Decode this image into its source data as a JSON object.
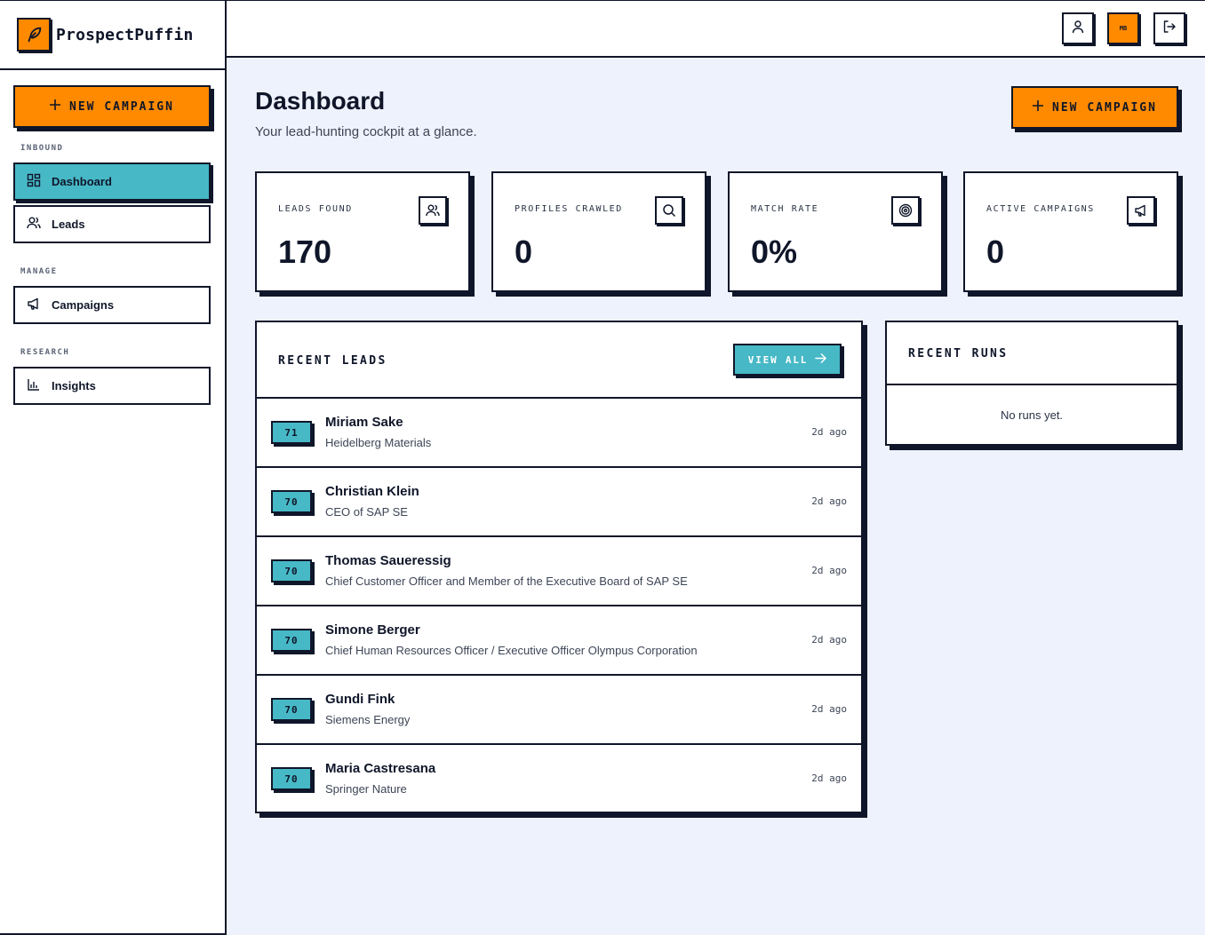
{
  "brand": {
    "name": "ProspectPuffin",
    "logo_icon": "feather-icon"
  },
  "sidebar": {
    "new_campaign_label": "NEW CAMPAIGN",
    "sections": [
      {
        "label": "INBOUND",
        "items": [
          {
            "label": "Dashboard",
            "icon": "grid-icon",
            "active": true
          },
          {
            "label": "Leads",
            "icon": "users-icon",
            "active": false
          }
        ]
      },
      {
        "label": "MANAGE",
        "items": [
          {
            "label": "Campaigns",
            "icon": "megaphone-icon",
            "active": false
          }
        ]
      },
      {
        "label": "RESEARCH",
        "items": [
          {
            "label": "Insights",
            "icon": "bar-chart-icon",
            "active": false
          }
        ]
      }
    ]
  },
  "topbar": {
    "avatar_initials": "MB",
    "icons": [
      "user-icon",
      "avatar",
      "logout-icon"
    ]
  },
  "page": {
    "title": "Dashboard",
    "subtitle": "Your lead-hunting cockpit at a glance.",
    "new_campaign_label": "NEW CAMPAIGN"
  },
  "stats": [
    {
      "label": "LEADS FOUND",
      "value": "170",
      "icon": "users-icon"
    },
    {
      "label": "PROFILES CRAWLED",
      "value": "0",
      "icon": "search-icon"
    },
    {
      "label": "MATCH RATE",
      "value": "0%",
      "icon": "target-icon"
    },
    {
      "label": "ACTIVE CAMPAIGNS",
      "value": "0",
      "icon": "megaphone-icon"
    }
  ],
  "recent_leads": {
    "title": "RECENT LEADS",
    "view_all_label": "VIEW ALL",
    "rows": [
      {
        "score": "71",
        "name": "Miriam Sake",
        "subtitle": "Heidelberg Materials",
        "time": "2d ago"
      },
      {
        "score": "70",
        "name": "Christian Klein",
        "subtitle": "CEO of SAP SE",
        "time": "2d ago"
      },
      {
        "score": "70",
        "name": "Thomas Saueressig",
        "subtitle": "Chief Customer Officer and Member of the Executive Board of SAP SE",
        "time": "2d ago"
      },
      {
        "score": "70",
        "name": "Simone Berger",
        "subtitle": "Chief Human Resources Officer / Executive Officer Olympus Corporation",
        "time": "2d ago"
      },
      {
        "score": "70",
        "name": "Gundi Fink",
        "subtitle": "Siemens Energy",
        "time": "2d ago"
      },
      {
        "score": "70",
        "name": "Maria Castresana",
        "subtitle": "Springer Nature",
        "time": "2d ago"
      }
    ]
  },
  "recent_runs": {
    "title": "RECENT RUNS",
    "empty_text": "No runs yet."
  },
  "colors": {
    "accent_orange": "#ff8a00",
    "accent_teal": "#47b8c6",
    "ink": "#0f1629",
    "background": "#eef2fd"
  }
}
